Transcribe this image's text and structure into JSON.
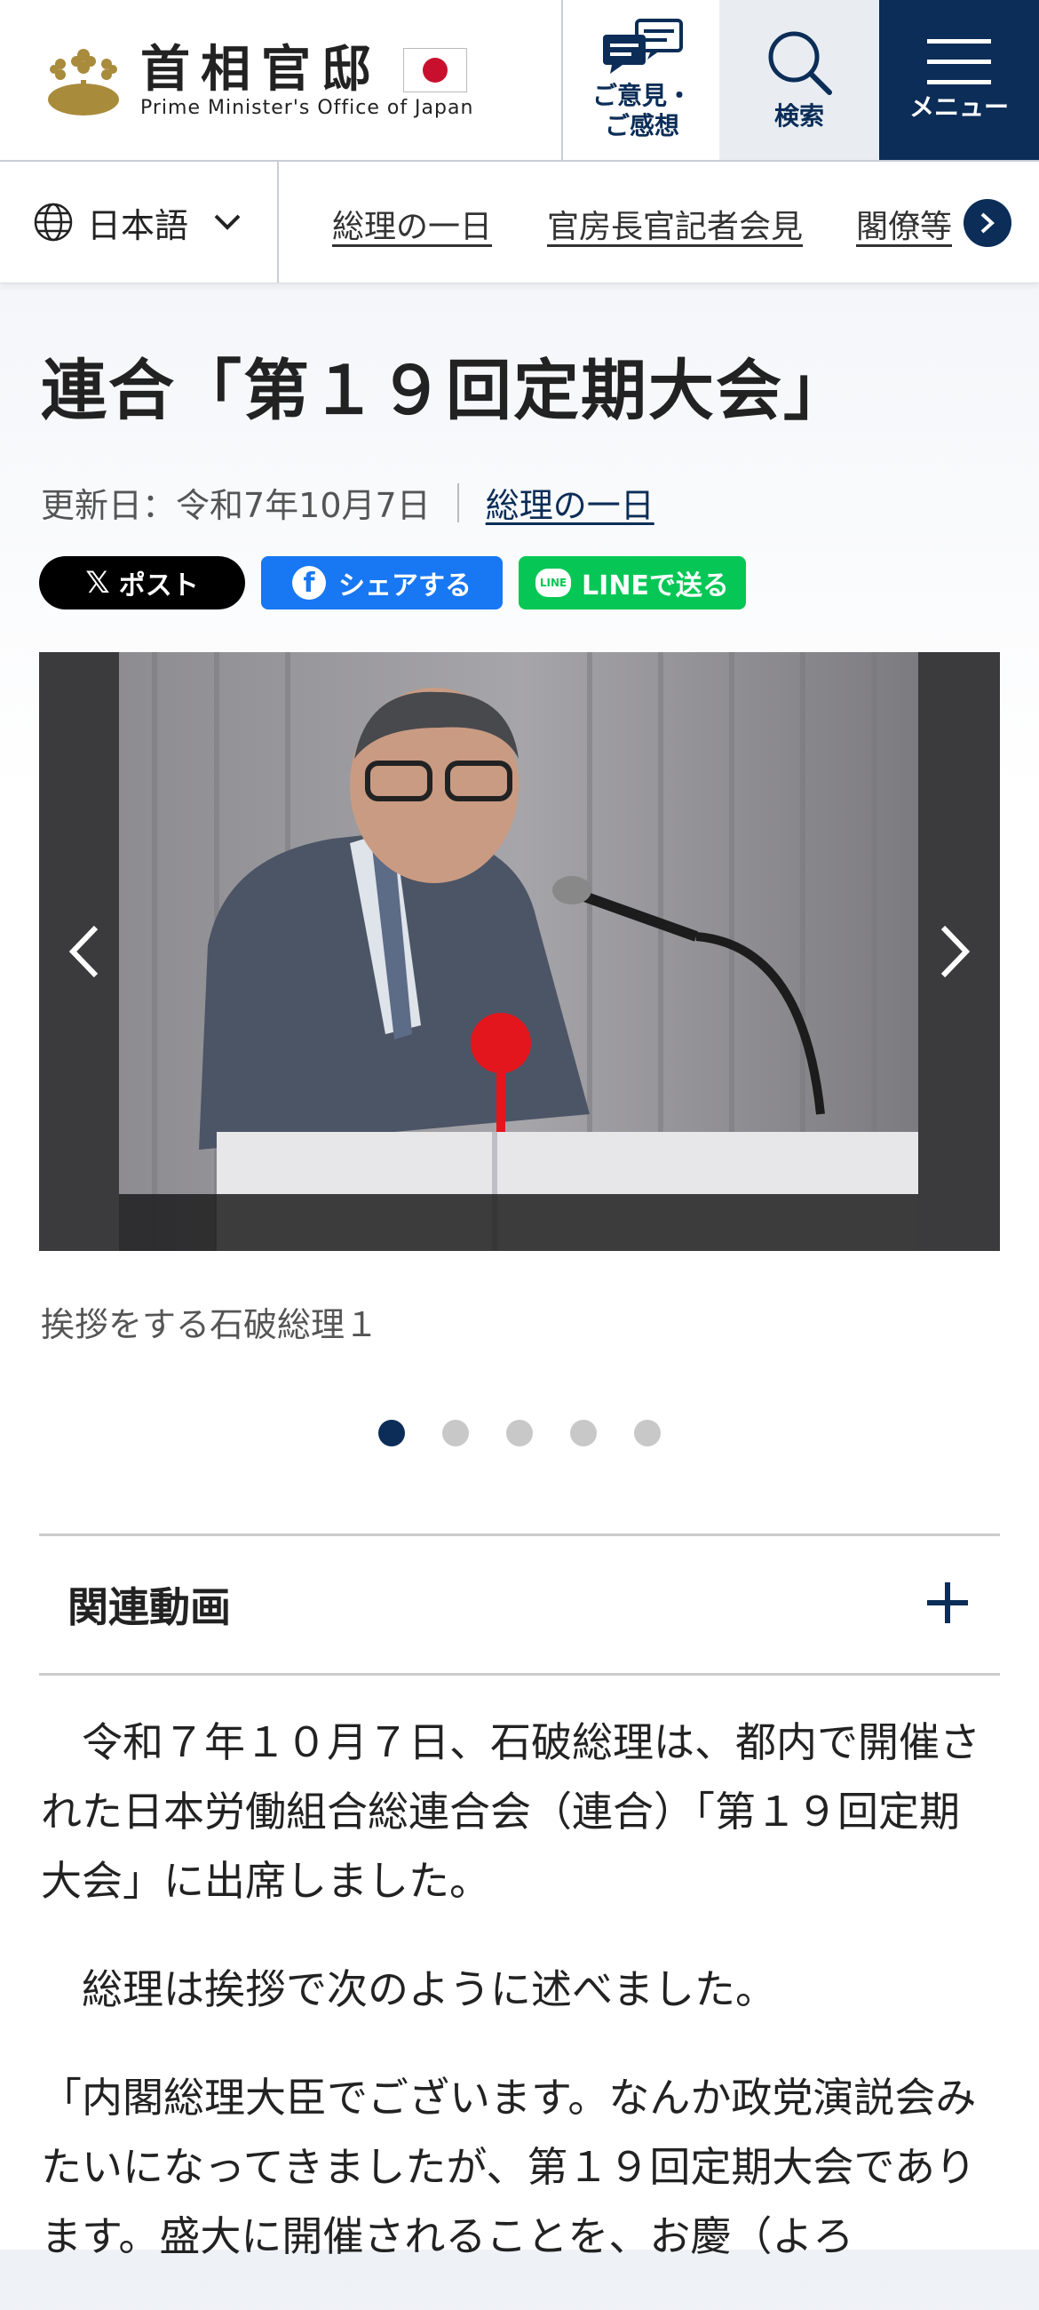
{
  "header": {
    "logo_jp": "首相官邸",
    "logo_en": "Prime Minister's Office of Japan",
    "opinion_line1": "ご意見・",
    "opinion_line2": "ご感想",
    "search_label": "検索",
    "menu_label": "メニュー"
  },
  "subnav": {
    "language": "日本語",
    "links": [
      "総理の一日",
      "官房長官記者会見",
      "閣僚等"
    ]
  },
  "article": {
    "title": "連合「第１９回定期大会」",
    "updated": "更新日：令和7年10月7日",
    "category": "総理の一日",
    "share": {
      "x": "ポスト",
      "facebook": "シェアする",
      "line": "LINEで送る"
    },
    "caption": "挨拶をする石破総理１",
    "slide_count": 5,
    "active_slide": 1,
    "accordion": "関連動画",
    "paragraphs": [
      "　令和７年１０月７日、石破総理は、都内で開催された日本労働組合総連合会（連合）「第１９回定期大会」に出席しました。",
      "　総理は挨拶で次のように述べました。",
      "「内閣総理大臣でございます。なんか政党演説会みたいになってきましたが、第１９回定期大会であります。盛大に開催されることを、お慶（よろ"
    ]
  },
  "colors": {
    "navy": "#0b2d57",
    "facebook": "#1877f2",
    "line": "#06c755"
  }
}
